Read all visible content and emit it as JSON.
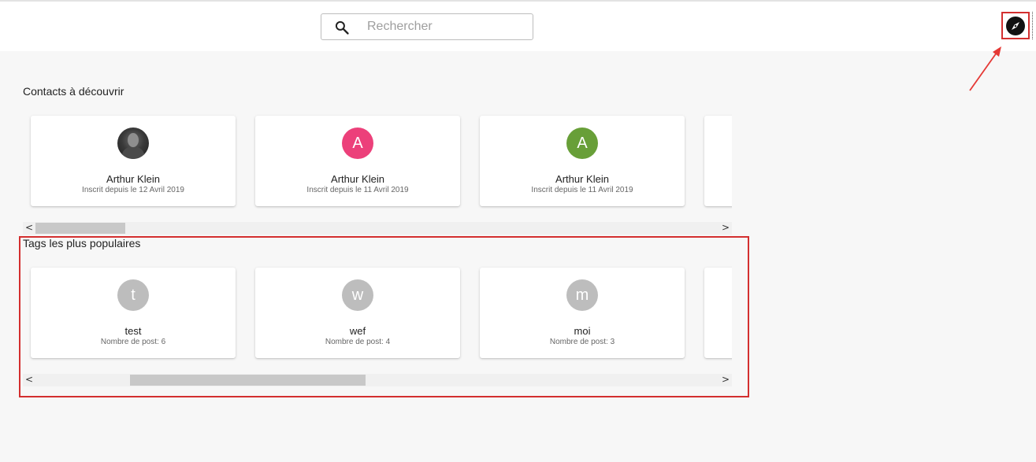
{
  "search": {
    "placeholder": "Rechercher",
    "value": "",
    "icon": "search-icon"
  },
  "explore_button": {
    "icon": "compass-icon"
  },
  "annotation_color": "#d32f2f",
  "contacts": {
    "title": "Contacts à découvrir",
    "items": [
      {
        "name": "Arthur Klein",
        "subtitle": "Inscrit depuis le 12 Avril 2019",
        "avatar": "photo",
        "color": "#2b2b2b",
        "initial": ""
      },
      {
        "name": "Arthur Klein",
        "subtitle": "Inscrit depuis le 11 Avril 2019",
        "avatar": "initial",
        "color": "#ec407a",
        "initial": "A"
      },
      {
        "name": "Arthur Klein",
        "subtitle": "Inscrit depuis le 11 Avril 2019",
        "avatar": "initial",
        "color": "#689f38",
        "initial": "A"
      }
    ],
    "scroll_position": 0.0
  },
  "tags": {
    "title": "Tags les plus populaires",
    "items": [
      {
        "name": "test",
        "subtitle": "Nombre de post: 6",
        "color": "#bdbdbd",
        "initial": "t"
      },
      {
        "name": "wef",
        "subtitle": "Nombre de post: 4",
        "color": "#bdbdbd",
        "initial": "w"
      },
      {
        "name": "moi",
        "subtitle": "Nombre de post: 3",
        "color": "#bdbdbd",
        "initial": "m"
      }
    ],
    "scroll_position": 0.15
  }
}
